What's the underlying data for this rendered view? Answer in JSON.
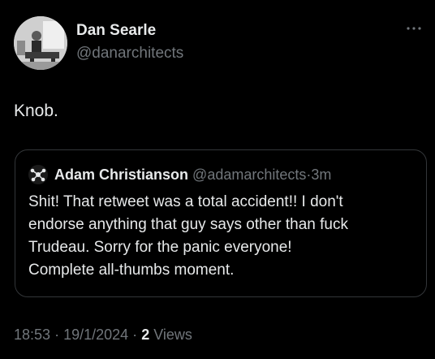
{
  "tweet": {
    "author": {
      "name": "Dan Searle",
      "handle": "@danarchitects",
      "avatar_icon": "profile-photo"
    },
    "text": "Knob.",
    "more_icon": "more-horizontal-icon",
    "quoted": {
      "author_name": "Adam Christianson",
      "handle": "@adamarchitects",
      "separator": "·",
      "time": "3m",
      "text": "Shit! That retweet was a total accident!! I don't\nendorse anything that guy says other than fuck\nTrudeau. Sorry for the panic everyone!\nComplete all-thumbs moment."
    },
    "meta": {
      "time": "18:53",
      "separator1": "·",
      "date": "19/1/2024",
      "separator2": "·",
      "views_count": "2",
      "views_label": "Views"
    }
  },
  "colors": {
    "background": "#000000",
    "primary_text": "#e7e9ea",
    "secondary_text": "#71767b",
    "border": "#333639"
  }
}
